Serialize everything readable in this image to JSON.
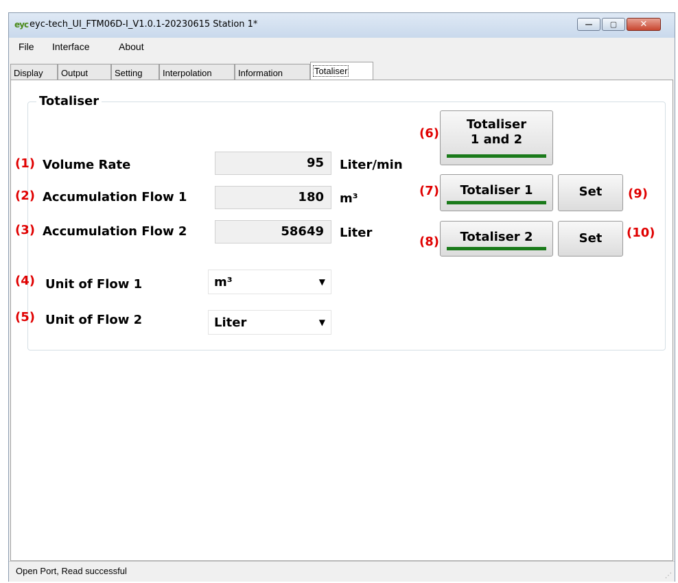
{
  "window": {
    "app_icon_text": "eyc",
    "title": "eyc-tech_UI_FTM06D-I_V1.0.1-20230615  Station 1*",
    "minimize_icon": "—",
    "maximize_icon": "▢",
    "close_icon": "✕"
  },
  "menu": [
    "File",
    "Interface",
    "About"
  ],
  "tabs": [
    "Display",
    "Output",
    "Setting",
    "Interpolation",
    "Information",
    "Totaliser"
  ],
  "active_tab": "Totaliser",
  "group": {
    "title": "Totaliser"
  },
  "rows": [
    {
      "num": "(1)",
      "label": "Volume Rate",
      "value": "95",
      "unit": "Liter/min"
    },
    {
      "num": "(2)",
      "label": "Accumulation Flow 1",
      "value": "180",
      "unit": "m³"
    },
    {
      "num": "(3)",
      "label": "Accumulation Flow 2",
      "value": "58649",
      "unit": "Liter"
    }
  ],
  "selects": [
    {
      "num": "(4)",
      "label": "Unit of Flow 1",
      "value": "m³"
    },
    {
      "num": "(5)",
      "label": "Unit of Flow 2",
      "value": "Liter"
    }
  ],
  "buttons": {
    "totaliser_both": {
      "num": "(6)",
      "line1": "Totaliser",
      "line2": "1 and 2"
    },
    "totaliser_1": {
      "num": "(7)",
      "label": "Totaliser 1"
    },
    "totaliser_2": {
      "num": "(8)",
      "label": "Totaliser 2"
    },
    "set_1": {
      "num": "(9)",
      "label": "Set"
    },
    "set_2": {
      "num": "(10)",
      "label": "Set"
    }
  },
  "colors": {
    "annotation": "#e00000",
    "indicator_bar": "#1a7a1a"
  },
  "status": {
    "text": "Open Port,    Read successful"
  }
}
